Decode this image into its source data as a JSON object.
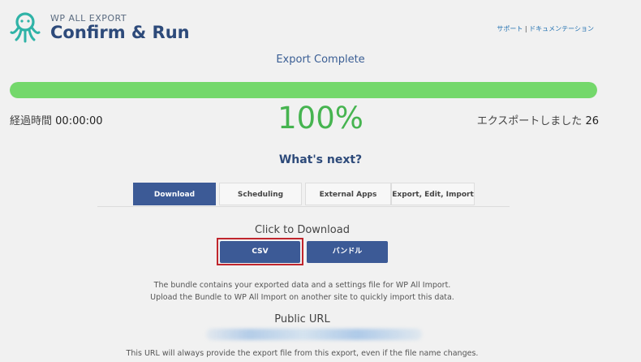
{
  "header": {
    "brand_small": "WP ALL EXPORT",
    "title": "Confirm & Run",
    "links": [
      "サポート",
      "ドキュメンテーション"
    ],
    "separator": "|"
  },
  "status": {
    "heading": "Export Complete",
    "progress": 1.0,
    "progress_color": "#74d86b",
    "elapsed_label": "経過時間",
    "elapsed_value": "00:00:00",
    "percent": "100%",
    "exported_label": "エクスポートしました",
    "exported_count": "26"
  },
  "next": {
    "heading": "What's next?",
    "tabs": [
      {
        "label": "Download",
        "active": true
      },
      {
        "label": "Scheduling",
        "active": false
      },
      {
        "label": "External Apps",
        "active": false
      },
      {
        "label": "Export, Edit, Import",
        "active": false
      }
    ]
  },
  "download": {
    "heading": "Click to Download",
    "csv_label": "CSV",
    "bundle_label": "バンドル",
    "desc_line1": "The bundle contains your exported data and a settings file for WP All Import.",
    "desc_line2": "Upload the Bundle to WP All Import on another site to quickly import this data.",
    "public_url_heading": "Public URL",
    "public_url_note": "This URL will always provide the export file from this export, even if the file name changes."
  },
  "colors": {
    "primary": "#3c5a96",
    "success": "#46b450",
    "highlight": "#c0262d"
  }
}
